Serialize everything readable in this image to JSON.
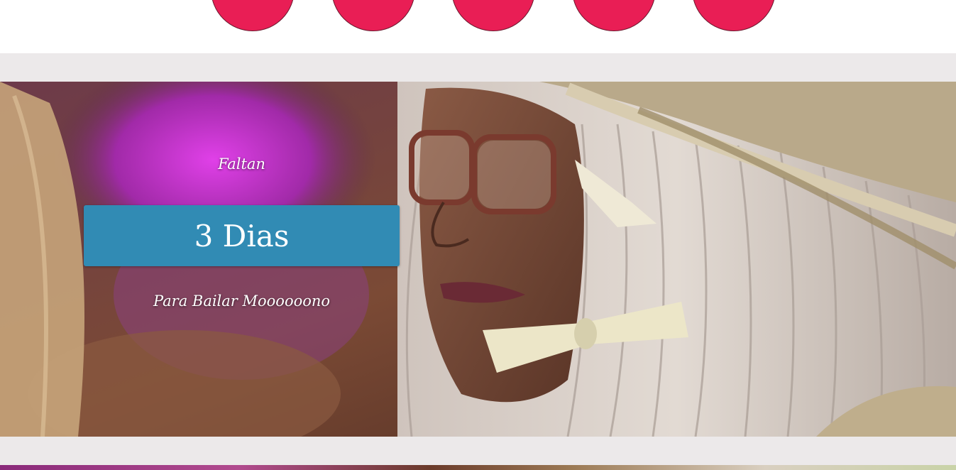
{
  "nav": {
    "items": [
      "",
      "",
      "",
      "",
      ""
    ],
    "accent_color": "#e91e55"
  },
  "hero": {
    "pre_label": "Faltan",
    "countdown": "3 Dias",
    "tagline": "Para Bailar Moooooono",
    "button_color": "#318bb4",
    "band_color": "#ece9ea"
  }
}
